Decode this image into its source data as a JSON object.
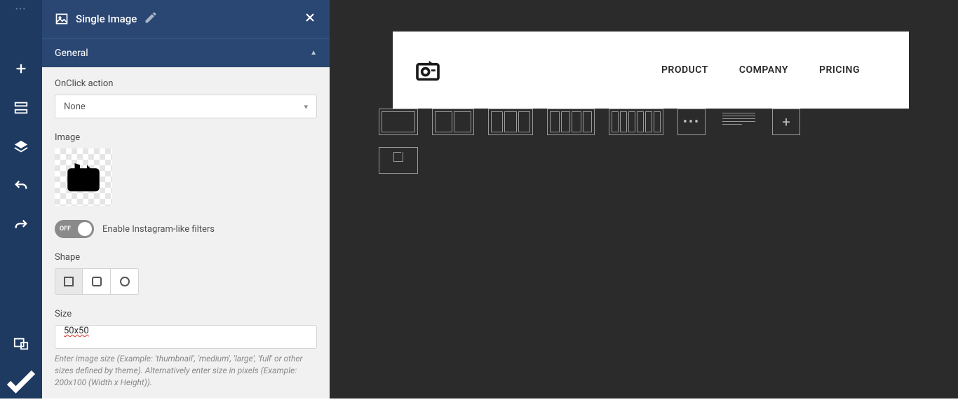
{
  "panel": {
    "title": "Single Image",
    "section": "General",
    "fields": {
      "onclick": {
        "label": "OnClick action",
        "value": "None"
      },
      "image": {
        "label": "Image"
      },
      "filters": {
        "toggle_label": "OFF",
        "text": "Enable Instagram-like filters"
      },
      "shape": {
        "label": "Shape"
      },
      "size": {
        "label": "Size",
        "value": "50x50",
        "help": "Enter image size (Example: 'thumbnail', 'medium', 'large', 'full' or other sizes defined by theme). Alternatively enter size in pixels (Example: 200x100 (Width x Height))."
      }
    }
  },
  "site": {
    "nav": [
      "PRODUCT",
      "COMPANY",
      "PRICING"
    ]
  }
}
